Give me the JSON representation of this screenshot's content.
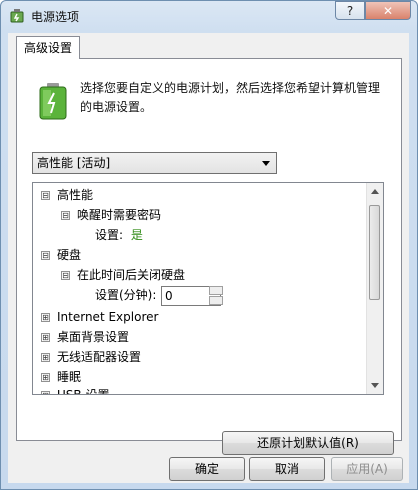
{
  "window": {
    "title": "电源选项",
    "help_label": "?",
    "close_label": "✕"
  },
  "tab": {
    "label": "高级设置"
  },
  "intro_text": "选择您要自定义的电源计划，然后选择您希望计算机管理的电源设置。",
  "plan_select": {
    "value": "高性能 [活动]"
  },
  "tree": [
    {
      "label": "高性能",
      "level": 0,
      "expander": "⊟"
    },
    {
      "label": "唤醒时需要密码",
      "level": 1,
      "expander": "⊟"
    },
    {
      "label": "设置:",
      "value": "是",
      "level": 2
    },
    {
      "label": "硬盘",
      "level": 0,
      "expander": "⊟"
    },
    {
      "label": "在此时间后关闭硬盘",
      "level": 1,
      "expander": "⊟"
    },
    {
      "label": "设置(分钟):",
      "value": "0",
      "level": 2
    },
    {
      "label": "Internet Explorer",
      "level": 0,
      "expander": "⊞"
    },
    {
      "label": "桌面背景设置",
      "level": 0,
      "expander": "⊞"
    },
    {
      "label": "无线适配器设置",
      "level": 0,
      "expander": "⊞"
    },
    {
      "label": "睡眠",
      "level": 0,
      "expander": "⊞"
    },
    {
      "label": "USB 设置",
      "level": 0,
      "expander": "⊞"
    }
  ],
  "buttons": {
    "restore": "还原计划默认值(R)",
    "ok": "确定",
    "cancel": "取消",
    "apply": "应用(A)"
  },
  "colors": {
    "accent_green": "#2f8a15"
  }
}
